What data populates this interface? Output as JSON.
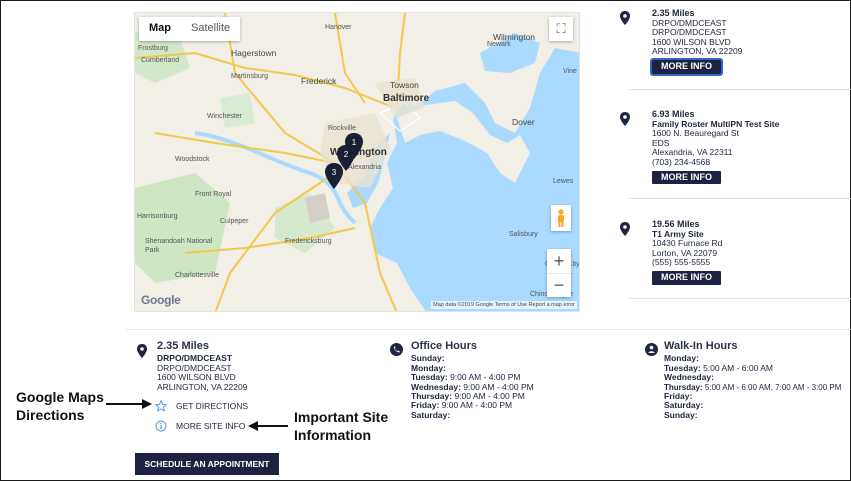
{
  "map": {
    "type_buttons": [
      "Map",
      "Satellite"
    ],
    "fullscreen_glyph": "⛶",
    "zoom_in": "+",
    "zoom_out": "−",
    "logo": "Google",
    "attribution": "Map data ©2019 Google   Terms of Use   Report a map error",
    "labels": {
      "frostburg": "Frostburg",
      "cumberland": "Cumberland",
      "hagerstown": "Hagerstown",
      "hanover": "Hanover",
      "wilmington": "Wilmington",
      "newark": "Newark",
      "martinsburg": "Martinsburg",
      "frederick": "Frederick",
      "towson": "Towson",
      "baltimore": "Baltimore",
      "vine": "Vine",
      "winchester": "Winchester",
      "rockville": "Rockville",
      "dover": "Dover",
      "washington": "Washington",
      "woodstock": "Woodstock",
      "alexandria": "Alexandria",
      "front_royal": "Front Royal",
      "lewes": "Lewes",
      "harrisonburg": "Harrisonburg",
      "culpeper": "Culpeper",
      "shenandoah": "Shenandoah National Park",
      "fredericksburg": "Fredericksburg",
      "salisbury": "Salisbury",
      "charlottesville": "Charlottesville",
      "ocean_city": "Ocean City",
      "chincoteague": "Chincoteague"
    },
    "markers": [
      "1",
      "2",
      "3"
    ]
  },
  "locations": [
    {
      "distance": "2.35 Miles",
      "lines": [
        "DRPO/DMDCEAST",
        "DRPO/DMDCEAST",
        "1600 WILSON BLVD",
        "ARLINGTON, VA 22209"
      ],
      "button": "MORE INFO"
    },
    {
      "distance": "6.93 Miles",
      "name": "Family Roster MultiPN Test Site",
      "lines": [
        "1600 N. Beauregard St",
        "EDS",
        "Alexandria, VA 22311",
        "(703) 234-4568"
      ],
      "button": "MORE INFO"
    },
    {
      "distance": "19.56 Miles",
      "name": "T1 Army Site",
      "lines": [
        "10430 Furnace Rd",
        "Lorton, VA 22079",
        "(555) 555-5555"
      ],
      "button": "MORE INFO"
    }
  ],
  "detail": {
    "distance": "2.35 Miles",
    "name": "DRPO/DMDCEAST",
    "lines": [
      "DRPO/DMDCEAST",
      "1600 WILSON BLVD",
      "ARLINGTON, VA 22209"
    ],
    "get_directions": "GET DIRECTIONS",
    "more_site_info": "MORE SITE INFO",
    "schedule": "SCHEDULE AN APPOINTMENT"
  },
  "office_hours": {
    "title": "Office Hours",
    "rows": [
      {
        "day": "Sunday:",
        "time": ""
      },
      {
        "day": "Monday:",
        "time": ""
      },
      {
        "day": "Tuesday:",
        "time": "9:00 AM - 4:00 PM"
      },
      {
        "day": "Wednesday:",
        "time": "9:00 AM - 4:00 PM"
      },
      {
        "day": "Thursday:",
        "time": "9:00 AM - 4:00 PM"
      },
      {
        "day": "Friday:",
        "time": "9:00 AM - 4:00 PM"
      },
      {
        "day": "Saturday:",
        "time": ""
      }
    ]
  },
  "walk_in_hours": {
    "title": "Walk-In Hours",
    "rows": [
      {
        "day": "Monday:",
        "time": ""
      },
      {
        "day": "Tuesday:",
        "time": "5:00 AM - 6:00 AM"
      },
      {
        "day": "Wednesday:",
        "time": ""
      },
      {
        "day": "Thursday:",
        "time": "5:00 AM - 6:00 AM, 7:00 AM - 3:00 PM"
      },
      {
        "day": "Friday:",
        "time": ""
      },
      {
        "day": "Saturday:",
        "time": ""
      },
      {
        "day": "Sunday:",
        "time": ""
      }
    ]
  },
  "annotations": {
    "google_maps_line1": "Google Maps",
    "google_maps_line2": "Directions",
    "important_line1": "Important Site",
    "important_line2": "Information"
  },
  "colors": {
    "navy_button": "#1d2242",
    "map_water": "#aadaff",
    "map_land": "#f2efe6",
    "accent_link": "#4a90d9"
  }
}
